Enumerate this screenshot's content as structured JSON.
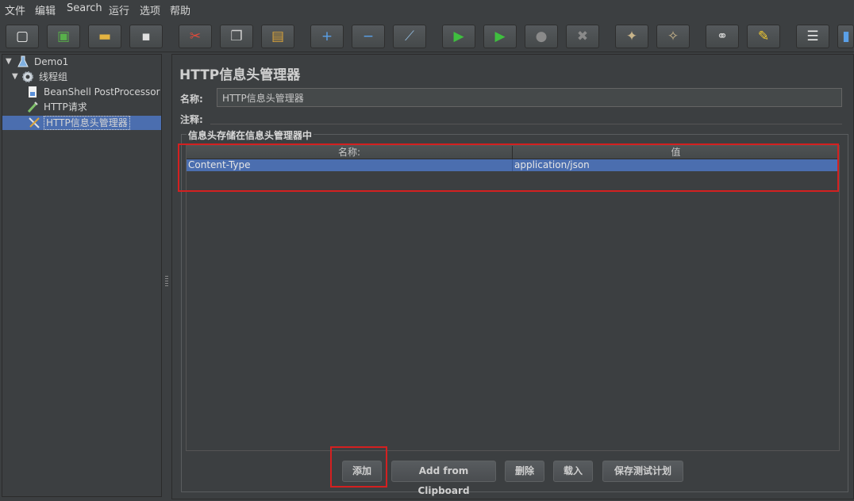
{
  "menu": [
    "文件",
    "编辑",
    "Search",
    "运行",
    "选项",
    "帮助"
  ],
  "toolbar": [
    {
      "icon": "new-file-icon",
      "glyph": "▢",
      "color": "#f0f0f0"
    },
    {
      "icon": "templates-icon",
      "glyph": "▣",
      "color": "#58b04a"
    },
    {
      "icon": "open-folder-icon",
      "glyph": "▬",
      "color": "#e3b341"
    },
    {
      "icon": "save-icon",
      "glyph": "▪",
      "color": "#e0e0e0"
    },
    {
      "icon": "cut-icon",
      "glyph": "✂",
      "color": "#e04a3a"
    },
    {
      "icon": "copy-icon",
      "glyph": "❐",
      "color": "#cfcfcf"
    },
    {
      "icon": "paste-icon",
      "glyph": "▤",
      "color": "#d9a33a"
    },
    {
      "icon": "expand-icon",
      "glyph": "+",
      "color": "#5aa0e8"
    },
    {
      "icon": "collapse-icon",
      "glyph": "−",
      "color": "#5aa0e8"
    },
    {
      "icon": "toggle-icon",
      "glyph": "⟋",
      "color": "#8fb6d8"
    },
    {
      "icon": "start-icon",
      "glyph": "▶",
      "color": "#3fbf3f"
    },
    {
      "icon": "start-no-pauses-icon",
      "glyph": "▶",
      "color": "#3fbf3f"
    },
    {
      "icon": "stop-icon",
      "glyph": "●",
      "color": "#8a8a8a"
    },
    {
      "icon": "shutdown-icon",
      "glyph": "✖",
      "color": "#8a8a8a"
    },
    {
      "icon": "clear-icon",
      "glyph": "✦",
      "color": "#c8b48a"
    },
    {
      "icon": "clear-all-icon",
      "glyph": "✧",
      "color": "#c8b48a"
    },
    {
      "icon": "search-binoculars-icon",
      "glyph": "⚭",
      "color": "#d0d0d0"
    },
    {
      "icon": "reset-search-icon",
      "glyph": "✎",
      "color": "#f0c830"
    },
    {
      "icon": "function-helper-icon",
      "glyph": "☰",
      "color": "#e8e8e8"
    },
    {
      "icon": "help-icon",
      "glyph": "▮",
      "color": "#5aa0e8"
    }
  ],
  "tree": {
    "root": "Demo1",
    "thread_group": "线程组",
    "items": [
      "BeanShell PostProcessor",
      "HTTP请求",
      "HTTP信息头管理器"
    ]
  },
  "panel": {
    "title": "HTTP信息头管理器",
    "name_label": "名称:",
    "name_value": "HTTP信息头管理器",
    "comment_label": "注释:",
    "comment_value": "",
    "group_title": "信息头存储在信息头管理器中"
  },
  "table": {
    "columns": [
      "名称:",
      "值"
    ],
    "rows": [
      {
        "name": "Content-Type",
        "value": "application/json"
      }
    ]
  },
  "buttons": {
    "add": "添加",
    "add_clipboard": "Add from Clipboard",
    "delete": "删除",
    "load": "载入",
    "save": "保存测试计划"
  }
}
